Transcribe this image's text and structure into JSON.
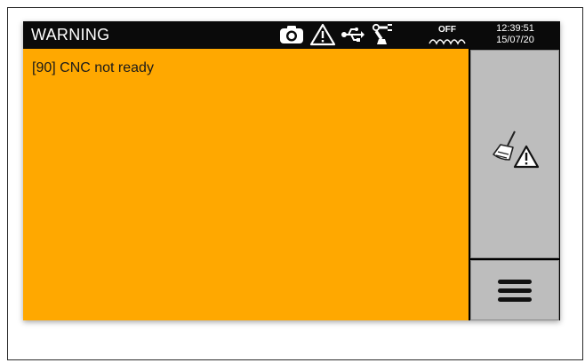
{
  "header": {
    "title": "WARNING",
    "status_icons": [
      "camera-icon",
      "warning-triangle-icon",
      "usb-icon",
      "robot-arm-icon",
      "coolant-off-icon"
    ],
    "coolant_label": "OFF",
    "time": "12:39:51",
    "date": "15/07/20"
  },
  "message_panel": {
    "message": "[90] CNC not ready",
    "background": "#ffa800"
  },
  "side_buttons": [
    {
      "name": "clear-warnings-button",
      "icon": "broom-warning-icon"
    },
    {
      "name": "menu-button",
      "icon": "hamburger-icon"
    }
  ]
}
